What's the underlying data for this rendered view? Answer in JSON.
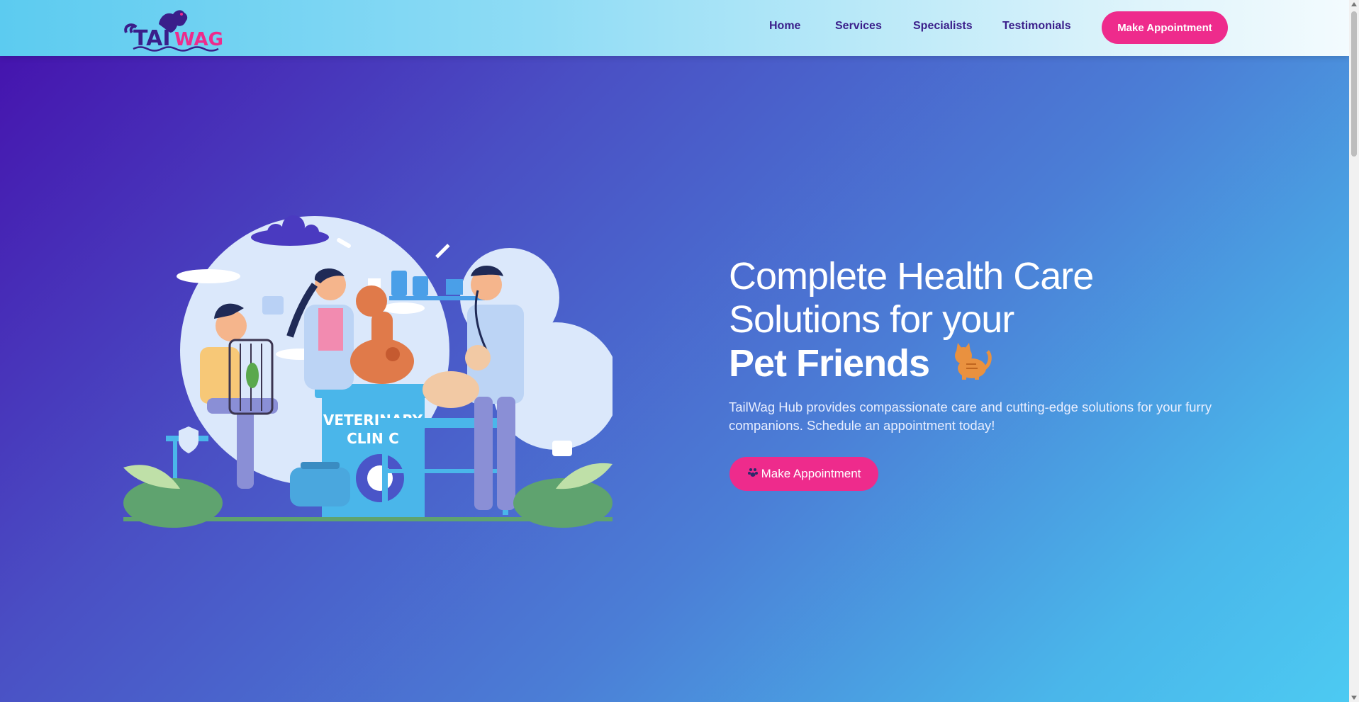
{
  "brand": {
    "name": "TAILWAG",
    "accent": "#ee2b8c",
    "navy": "#3a1e8a"
  },
  "nav": {
    "links": [
      "Home",
      "Services",
      "Specialists",
      "Testimonials"
    ],
    "cta_label": "Make Appointment"
  },
  "hero": {
    "title_line1": "Complete Health Care",
    "title_line2": "Solutions for your",
    "title_strong": "Pet Friends",
    "title_emoji": "cat-icon",
    "description": "TailWag Hub provides compassionate care and cutting-edge solutions for your furry companions. Schedule an appointment today!",
    "cta_label": "Make Appointment",
    "cta_icon": "paw-icon",
    "illustration_sign": "VETERINARY CLINIC"
  },
  "colors": {
    "nav_gradient_start": "#5ccbf0",
    "nav_gradient_end": "#f3fbfe",
    "hero_gradient_start": "#4514ae",
    "hero_gradient_end": "#4ccaf2"
  }
}
